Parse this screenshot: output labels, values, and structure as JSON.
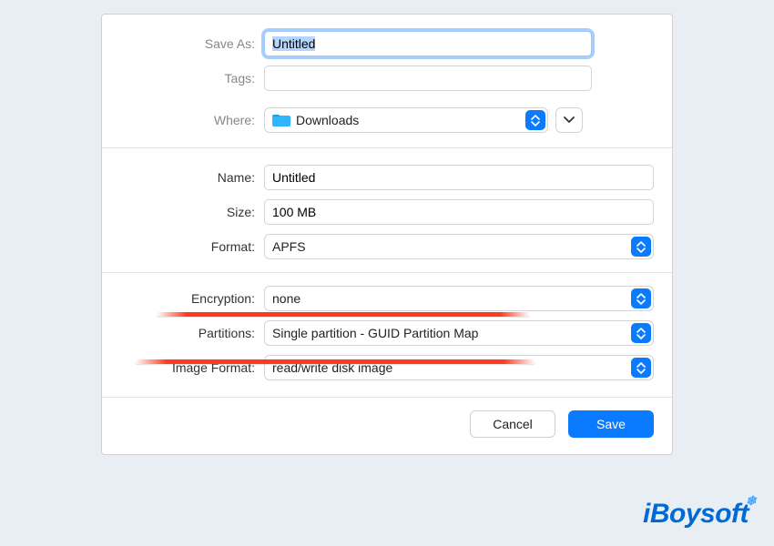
{
  "save_panel": {
    "save_as_label": "Save As:",
    "save_as_value": "Untitled",
    "tags_label": "Tags:",
    "tags_value": "",
    "where_label": "Where:",
    "where_value": "Downloads"
  },
  "image_options": {
    "name_label": "Name:",
    "name_value": "Untitled",
    "size_label": "Size:",
    "size_value": "100 MB",
    "format_label": "Format:",
    "format_value": "APFS",
    "encryption_label": "Encryption:",
    "encryption_value": "none",
    "partitions_label": "Partitions:",
    "partitions_value": "Single partition - GUID Partition Map",
    "image_format_label": "Image Format:",
    "image_format_value": "read/write disk image"
  },
  "buttons": {
    "cancel": "Cancel",
    "save": "Save"
  },
  "branding": {
    "logo_text": "iBoysoft"
  }
}
